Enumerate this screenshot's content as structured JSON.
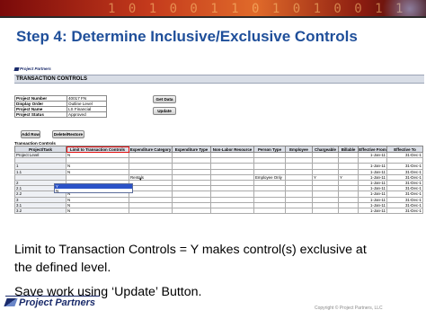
{
  "banner": {
    "digits": "1 0 1 0 0 1 1 0 1 0 1 0 0 1 1"
  },
  "slide": {
    "title": "Step 4: Determine Inclusive/Exclusive Controls",
    "body1a": "Limit to Transaction Controls = Y makes control(s) exclusive at",
    "body1b": "the defined level.",
    "body2": "Save work using ‘Update’ Button."
  },
  "app": {
    "logo": "Project Partners",
    "page_title": "TRANSACTION CONTROLS",
    "info": [
      {
        "label": "Project Number",
        "value": "40017 FN"
      },
      {
        "label": "Display Order",
        "value": "Outline Level"
      },
      {
        "label": "Project Name",
        "value": "LS Financial"
      },
      {
        "label": "Project Status",
        "value": "Approved"
      }
    ],
    "buttons": {
      "get_data": "Get Data",
      "update": "Update",
      "add_row": "Add Row",
      "delete_restore": "Delete/Restore"
    },
    "section_label": "Transaction Controls",
    "columns": [
      "Project/Task",
      "Limit to Transaction Controls",
      "Expenditure Category",
      "Expenditure Type",
      "Non-Labor Resource",
      "Person Type",
      "Employee",
      "Chargeable",
      "Billable",
      "Effective From",
      "Effective To"
    ],
    "rows": [
      [
        "Project Level",
        "N",
        "",
        "",
        "",
        "",
        "",
        "",
        "",
        "1-Jan-11",
        "31-Dec-1"
      ],
      [
        "",
        "",
        "",
        "",
        "",
        "",
        "",
        "",
        "",
        "",
        ""
      ],
      [
        "1",
        "N",
        "",
        "",
        "",
        "",
        "",
        "",
        "",
        "1-Jan-11",
        "31-Dec-1"
      ],
      [
        "1.1",
        "N",
        "",
        "",
        "",
        "",
        "",
        "",
        "",
        "1-Jan-11",
        "31-Dec-1"
      ],
      [
        "",
        "",
        "Rentals",
        "",
        "",
        "Employee Only",
        "",
        "Y",
        "Y",
        "1-Jan-11",
        "31-Dec-1"
      ],
      [
        "2",
        "",
        "",
        "",
        "",
        "",
        "",
        "",
        "",
        "1-Jan-11",
        "31-Dec-1"
      ],
      [
        "2.1",
        "N",
        "",
        "",
        "",
        "",
        "",
        "",
        "",
        "1-Jan-11",
        "31-Dec-1"
      ],
      [
        "2.2",
        "N",
        "",
        "",
        "",
        "",
        "",
        "",
        "",
        "1-Jan-11",
        "31-Dec-1"
      ],
      [
        "3",
        "N",
        "",
        "",
        "",
        "",
        "",
        "",
        "",
        "1-Jan-11",
        "31-Dec-1"
      ],
      [
        "3.1",
        "N",
        "",
        "",
        "",
        "",
        "",
        "",
        "",
        "1-Jan-11",
        "31-Dec-1"
      ],
      [
        "3.2",
        "N",
        "",
        "",
        "",
        "",
        "",
        "",
        "",
        "1-Jan-11",
        "31-Dec-1"
      ]
    ],
    "dropdown_options": [
      "Y",
      "N"
    ]
  },
  "footer": {
    "logo": "Project Partners",
    "copyright": "Copyright © Project Partners, LLC"
  },
  "colors": {
    "title": "#1f4f9a",
    "highlight": "#e01010",
    "selection": "#2a52c8"
  }
}
